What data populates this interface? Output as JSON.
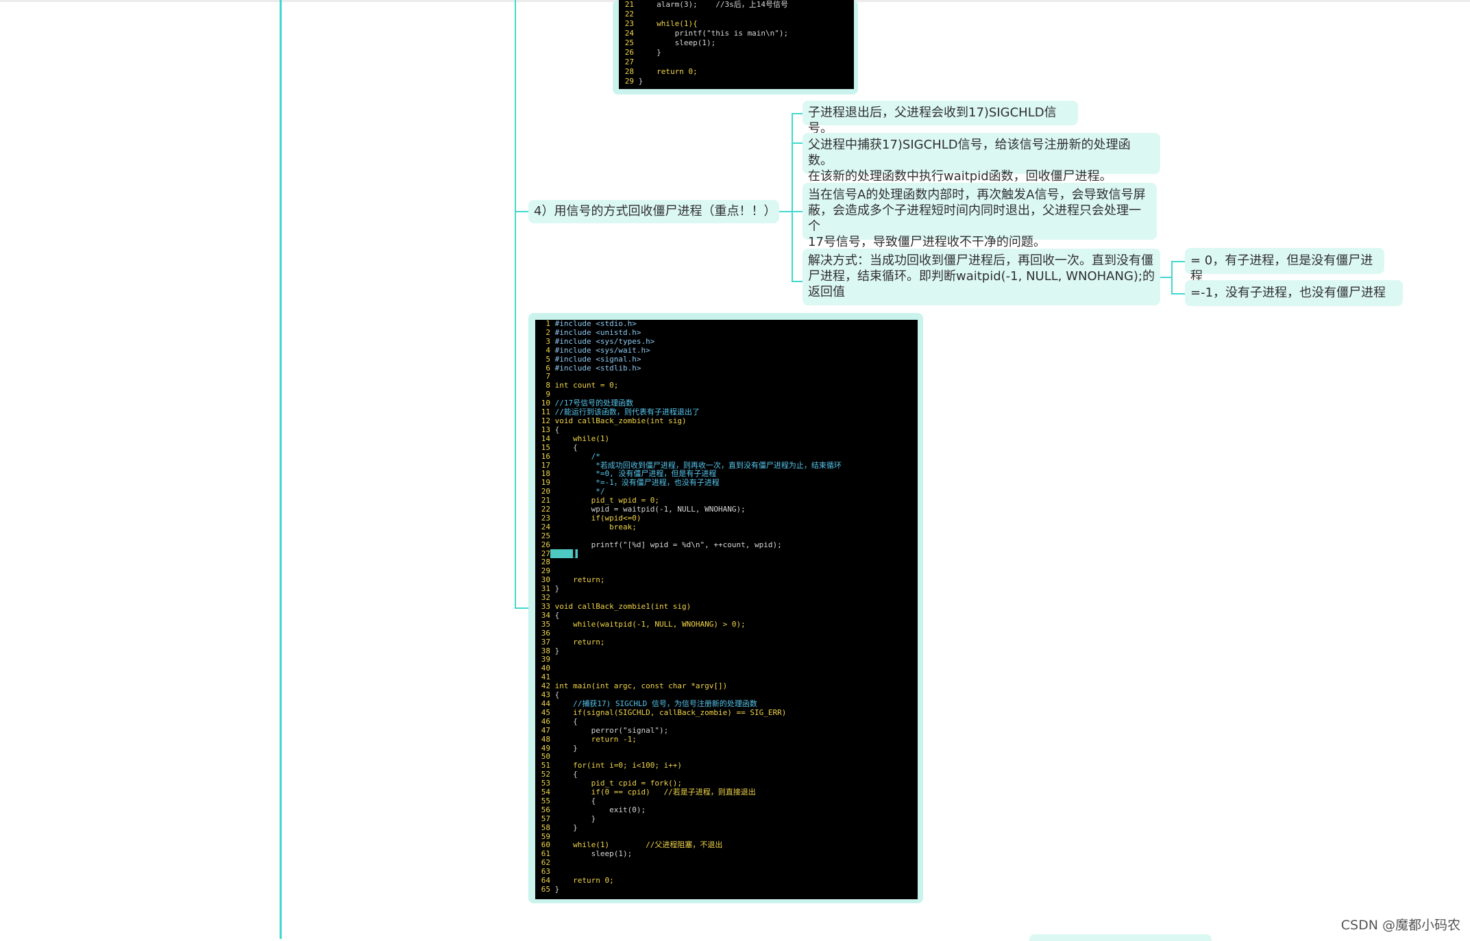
{
  "colors": {
    "connector": "#3fd8cd",
    "node_bg": "#dcf8f3",
    "image_frame": "#c9f3ec",
    "code_bg": "#000000"
  },
  "nodes": {
    "topic4": "4）用信号的方式回收僵尸进程（重点！！）",
    "child1": "子进程退出后，父进程会收到17)SIGCHLD信号。",
    "child2_line1": "父进程中捕获17)SIGCHLD信号，给该信号注册新的处理函数。",
    "child2_line2": "在该新的处理函数中执行waitpid函数，回收僵尸进程。",
    "child3_line1": "当在信号A的处理函数内部时，再次触发A信号，会导致信号屏",
    "child3_line2": "蔽，会造成多个子进程短时间内同时退出，父进程只会处理一个",
    "child3_line3": "17号信号，导致僵尸进程收不干净的问题。",
    "child4_line1": "解决方式：当成功回收到僵尸进程后，再回收一次。直到没有僵",
    "child4_line2": "尸进程，结束循环。即判断waitpid(-1, NULL, WNOHANG);的",
    "child4_line3": "返回值",
    "result_zero": "= 0，有子进程，但是没有僵尸进程",
    "result_neg": "=-1，没有子进程，也没有僵尸进程"
  },
  "top_code": [
    {
      "n": "21",
      "t": "    alarm(3);    //3s后，上14号信号"
    },
    {
      "n": "22",
      "t": ""
    },
    {
      "n": "23",
      "t": "    while(1){"
    },
    {
      "n": "24",
      "t": "        printf(\"this is main\\n\");"
    },
    {
      "n": "25",
      "t": "        sleep(1);"
    },
    {
      "n": "26",
      "t": "    }"
    },
    {
      "n": "27",
      "t": ""
    },
    {
      "n": "28",
      "t": "    return 0;"
    },
    {
      "n": "29",
      "t": "}"
    }
  ],
  "main_code": [
    {
      "n": "1",
      "t": "#include <stdio.h>"
    },
    {
      "n": "2",
      "t": "#include <unistd.h>"
    },
    {
      "n": "3",
      "t": "#include <sys/types.h>"
    },
    {
      "n": "4",
      "t": "#include <sys/wait.h>"
    },
    {
      "n": "5",
      "t": "#include <signal.h>"
    },
    {
      "n": "6",
      "t": "#include <stdlib.h>"
    },
    {
      "n": "7",
      "t": ""
    },
    {
      "n": "8",
      "t": "int count = 0;"
    },
    {
      "n": "9",
      "t": ""
    },
    {
      "n": "10",
      "t": "//17号信号的处理函数"
    },
    {
      "n": "11",
      "t": "//能运行到该函数，则代表有子进程退出了"
    },
    {
      "n": "12",
      "t": "void callBack_zombie(int sig)"
    },
    {
      "n": "13",
      "t": "{"
    },
    {
      "n": "14",
      "t": "    while(1)"
    },
    {
      "n": "15",
      "t": "    {"
    },
    {
      "n": "16",
      "t": "        /*"
    },
    {
      "n": "17",
      "t": "         *若成功回收到僵尸进程，则再收一次，直到没有僵尸进程为止，结束循环"
    },
    {
      "n": "18",
      "t": "         *=0, 没有僵尸进程，但是有子进程"
    },
    {
      "n": "19",
      "t": "         *=-1，没有僵尸进程，也没有子进程"
    },
    {
      "n": "20",
      "t": "         */"
    },
    {
      "n": "21",
      "t": "        pid_t wpid = 0;"
    },
    {
      "n": "22",
      "t": "        wpid = waitpid(-1, NULL, WNOHANG);"
    },
    {
      "n": "23",
      "t": "        if(wpid<=0)"
    },
    {
      "n": "24",
      "t": "            break;"
    },
    {
      "n": "25",
      "t": ""
    },
    {
      "n": "26",
      "t": "        printf(\"[%d] wpid = %d\\n\", ++count, wpid);"
    },
    {
      "n": "27",
      "t": "    ▌"
    },
    {
      "n": "28",
      "t": ""
    },
    {
      "n": "29",
      "t": ""
    },
    {
      "n": "30",
      "t": "    return;"
    },
    {
      "n": "31",
      "t": "}"
    },
    {
      "n": "32",
      "t": ""
    },
    {
      "n": "33",
      "t": "void callBack_zombie1(int sig)"
    },
    {
      "n": "34",
      "t": "{"
    },
    {
      "n": "35",
      "t": "    while(waitpid(-1, NULL, WNOHANG) > 0);"
    },
    {
      "n": "36",
      "t": ""
    },
    {
      "n": "37",
      "t": "    return;"
    },
    {
      "n": "38",
      "t": "}"
    },
    {
      "n": "39",
      "t": ""
    },
    {
      "n": "40",
      "t": ""
    },
    {
      "n": "41",
      "t": ""
    },
    {
      "n": "42",
      "t": "int main(int argc, const char *argv[])"
    },
    {
      "n": "43",
      "t": "{"
    },
    {
      "n": "44",
      "t": "    //捕获17) SIGCHLD 信号，为信号注册新的处理函数"
    },
    {
      "n": "45",
      "t": "    if(signal(SIGCHLD, callBack_zombie) == SIG_ERR)"
    },
    {
      "n": "46",
      "t": "    {"
    },
    {
      "n": "47",
      "t": "        perror(\"signal\");"
    },
    {
      "n": "48",
      "t": "        return -1;"
    },
    {
      "n": "49",
      "t": "    }"
    },
    {
      "n": "50",
      "t": ""
    },
    {
      "n": "51",
      "t": "    for(int i=0; i<100; i++)"
    },
    {
      "n": "52",
      "t": "    {"
    },
    {
      "n": "53",
      "t": "        pid_t cpid = fork();"
    },
    {
      "n": "54",
      "t": "        if(0 == cpid)   //若是子进程，则直接退出"
    },
    {
      "n": "55",
      "t": "        {"
    },
    {
      "n": "56",
      "t": "            exit(0);"
    },
    {
      "n": "57",
      "t": "        }"
    },
    {
      "n": "58",
      "t": "    }"
    },
    {
      "n": "59",
      "t": ""
    },
    {
      "n": "60",
      "t": "    while(1)        //父进程阻塞，不退出"
    },
    {
      "n": "61",
      "t": "        sleep(1);"
    },
    {
      "n": "62",
      "t": ""
    },
    {
      "n": "63",
      "t": ""
    },
    {
      "n": "64",
      "t": "    return 0;"
    },
    {
      "n": "65",
      "t": "}"
    }
  ],
  "watermark": "CSDN @魔都小码农"
}
